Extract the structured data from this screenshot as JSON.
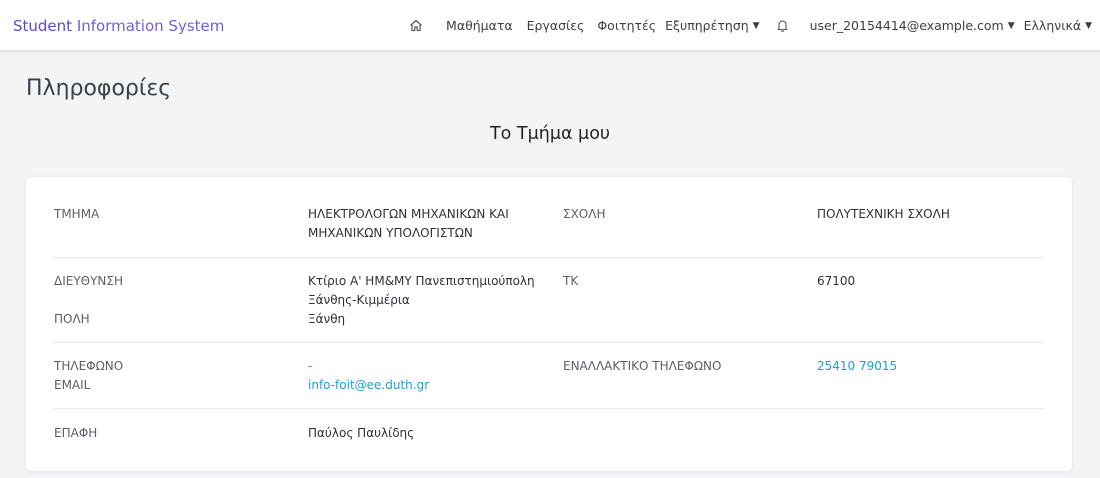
{
  "navbar": {
    "brand_first": "Student",
    "brand_rest": " Information System",
    "home_icon": "home-icon",
    "items": [
      "Μαθήματα",
      "Εργασίες",
      "Φοιτητές"
    ],
    "services_label": "Εξυπηρέτηση",
    "bell_icon": "bell-icon",
    "user_label": "user_20154414@example.com",
    "language_label": "Ελληνικά"
  },
  "page": {
    "title": "Πληροφορίες",
    "section_title": "Το Τμήμα μου"
  },
  "info": {
    "department_label": "ΤΜΗΜΑ",
    "department_line1": "ΗΛΕΚΤΡΟΛΟΓΩΝ ΜΗΧΑΝΙΚΩΝ ΚΑΙ",
    "department_line2": "ΜΗΧΑΝΙΚΩΝ ΥΠΟΛΟΓΙΣΤΩΝ",
    "school_label": "ΣΧΟΛΗ",
    "school_value": "ΠΟΛΥΤΕΧΝΙΚΗ ΣΧΟΛΗ",
    "address_label": "ΔΙΕΥΘΥΝΣΗ",
    "address_line1": "Κτίριο Α' ΗΜ&ΜΥ Πανεπιστημιούπολη",
    "address_line2": "Ξάνθης-Κιμμέρια",
    "city_label": "ΠΟΛΗ",
    "city_value": "Ξάνθη",
    "postal_label": "ΤΚ",
    "postal_value": "67100",
    "phone_label": "ΤΗΛΕΦΩΝΟ",
    "phone_value": "-",
    "email_label": "EMAIL",
    "email_value": "info-foit@ee.duth.gr",
    "alt_phone_label": "ΕΝΑΛΛΑΚΤΙΚΟ ΤΗΛΕΦΩΝΟ",
    "alt_phone_value": "25410 79015",
    "contact_label": "ΕΠΑΦΗ",
    "contact_value": "Παύλος Παυλίδης"
  },
  "colors": {
    "brand": "#5b49d6",
    "link": "#1e9fd8",
    "background": "#f3f4f5"
  }
}
